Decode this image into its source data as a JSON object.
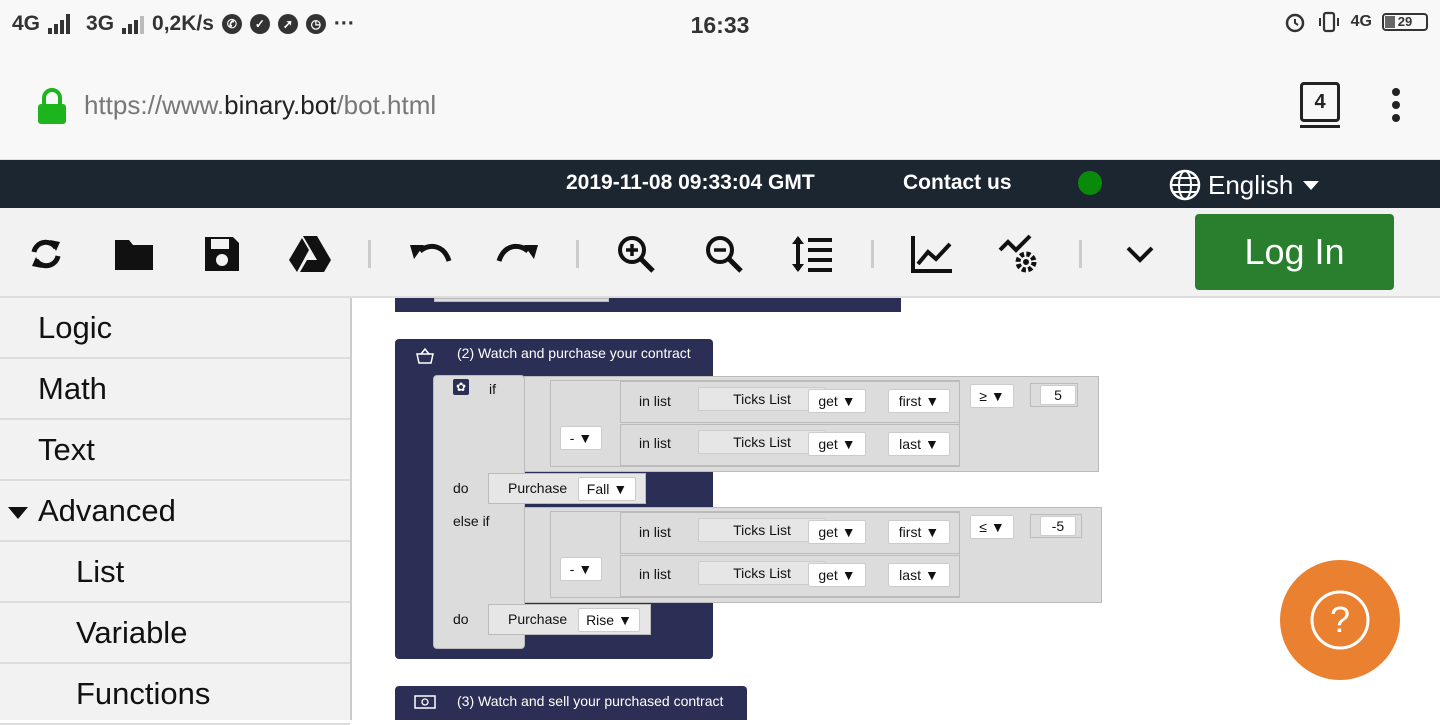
{
  "status_bar": {
    "network_1": "4G",
    "network_2": "3G",
    "speed": "0,2K/s",
    "time": "16:33",
    "lte": "4G",
    "battery": "29"
  },
  "browser": {
    "url_prefix": "https://www.",
    "url_domain": "binary.bot",
    "url_path": "/bot.html",
    "tab_count": "4"
  },
  "topbar": {
    "datetime": "2019-11-08 09:33:04 GMT",
    "contact": "Contact us",
    "language": "English",
    "status_color": "#0a8a0a"
  },
  "toolbar": {
    "login": "Log In",
    "accent": "#2a7f2e"
  },
  "sidebar": {
    "items": [
      {
        "label": "Logic"
      },
      {
        "label": "Math"
      },
      {
        "label": "Text"
      },
      {
        "label": "Advanced"
      },
      {
        "label": "List"
      },
      {
        "label": "Variable"
      },
      {
        "label": "Functions"
      }
    ]
  },
  "workspace": {
    "block2_title": "(2) Watch and purchase your contract",
    "block3_title": "(3) Watch and sell your purchased contract",
    "if_label": "if",
    "do_label": "do",
    "else_if_label": "else if",
    "in_list": "in list",
    "ticks_list": "Ticks List",
    "get": "get",
    "first": "first",
    "last": "last",
    "minus_op": "-",
    "gte": "≥",
    "lte": "≤",
    "value_1": "5",
    "value_2": "-5",
    "purchase": "Purchase",
    "fall": "Fall",
    "rise": "Rise",
    "arrow": "▼"
  },
  "help": {
    "symbol": "?",
    "color": "#ea8131"
  }
}
